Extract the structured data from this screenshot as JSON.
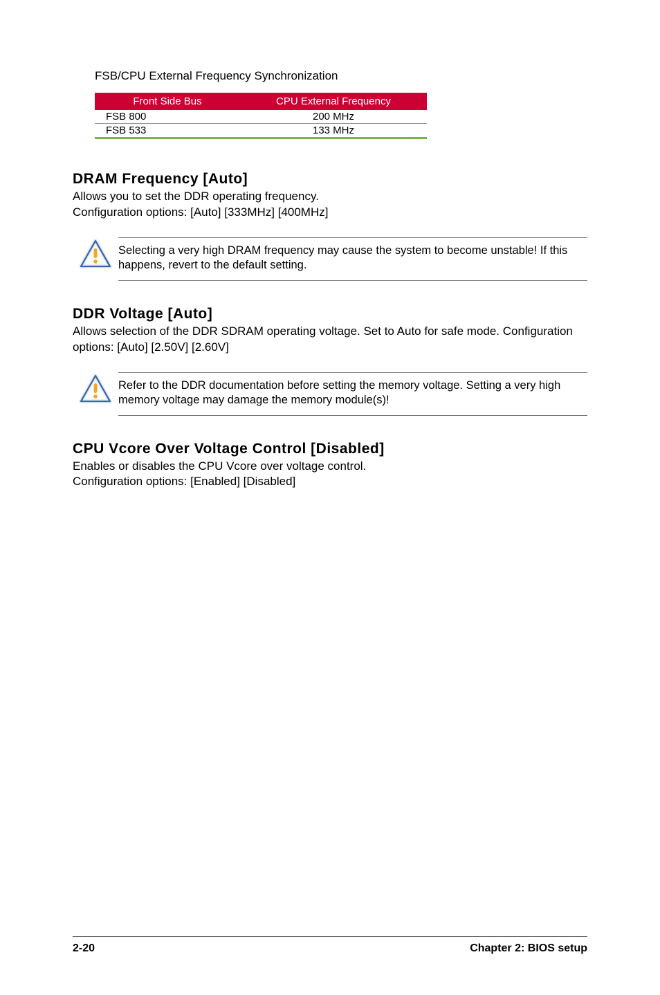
{
  "fsb_sync_label": "FSB/CPU External Frequency Synchronization",
  "table": {
    "headers": [
      "Front Side Bus",
      "CPU External Frequency"
    ],
    "rows": [
      [
        "FSB 800",
        "200 MHz"
      ],
      [
        "FSB 533",
        "133 MHz"
      ]
    ]
  },
  "sections": [
    {
      "heading": "DRAM Frequency [Auto]",
      "body": "Allows you to set the DDR operating frequency.\nConfiguration options: [Auto] [333MHz] [400MHz]",
      "note": "Selecting a very high DRAM frequency may cause the system to become unstable! If this happens, revert to the default setting."
    },
    {
      "heading": "DDR Voltage [Auto]",
      "body": "Allows selection of the DDR SDRAM operating voltage. Set to Auto for safe mode. Configuration options: [Auto] [2.50V] [2.60V]",
      "note": "Refer to the DDR documentation before setting the memory voltage. Setting a very high memory voltage may damage the memory module(s)!"
    },
    {
      "heading": "CPU Vcore Over Voltage Control [Disabled]",
      "body": "Enables or disables the CPU Vcore over voltage control.\nConfiguration options: [Enabled] [Disabled]",
      "note": null
    }
  ],
  "footer": {
    "page": "2-20",
    "chapter": "Chapter 2: BIOS setup"
  },
  "icon_name": "caution-triangle-icon"
}
